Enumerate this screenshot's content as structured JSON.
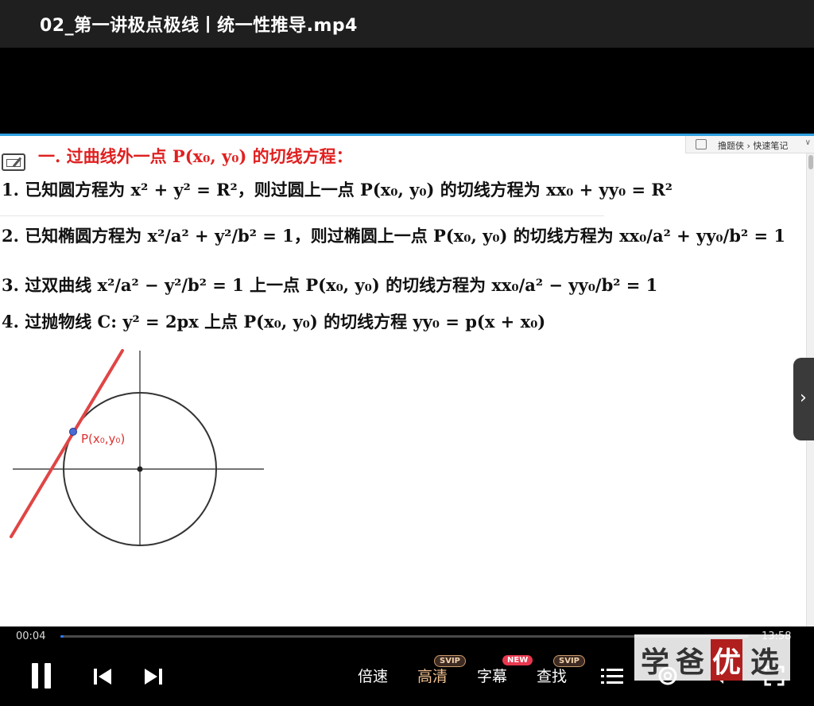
{
  "window": {
    "title": "02_第一讲极点极线丨统一性推导.mp4"
  },
  "screen_toolbar": {
    "label": "撸题侠 › 快速笔记",
    "chevron": "∨"
  },
  "slide": {
    "heading": "一. 过曲线外一点 P(x₀, y₀) 的切线方程：",
    "items": [
      "1. 已知圆方程为 x² + y² = R²，则过圆上一点 P(x₀, y₀) 的切线方程为 xx₀ + yy₀ = R²",
      "2. 已知椭圆方程为 x²/a² + y²/b² = 1，则过椭圆上一点 P(x₀, y₀) 的切线方程为 xx₀/a² + yy₀/b² = 1",
      "3. 过双曲线 x²/a² − y²/b² = 1 上一点 P(x₀, y₀) 的切线方程为 xx₀/a² − yy₀/b² = 1",
      "4. 过抛物线 C: y² = 2px 上点 P(x₀, y₀) 的切线方程 yy₀ = p(x + x₀)"
    ],
    "graph_point_label": "P(x₀,y₀)"
  },
  "nav": {
    "next_glyph": "›"
  },
  "player": {
    "current_time": "00:04",
    "total_time": "13:58",
    "progress_fraction": 0.005,
    "speed_label": "倍速",
    "quality_label": "高清",
    "subtitle_label": "字幕",
    "search_label": "查找",
    "badge_svip": "SVIP",
    "badge_new": "NEW"
  },
  "watermark": {
    "chars": [
      "学",
      "爸",
      "优",
      "选"
    ]
  },
  "colors": {
    "heading_red": "#e02020",
    "accent_blue": "#2fa0e0",
    "progress_blue": "#2f7bff",
    "quality_gold": "#f0c090"
  },
  "icons": [
    "edit-icon",
    "pause-icon",
    "previous-icon",
    "next-icon",
    "playlist-icon",
    "settings-icon",
    "volume-icon",
    "fullscreen-icon",
    "chevron-right-icon"
  ]
}
